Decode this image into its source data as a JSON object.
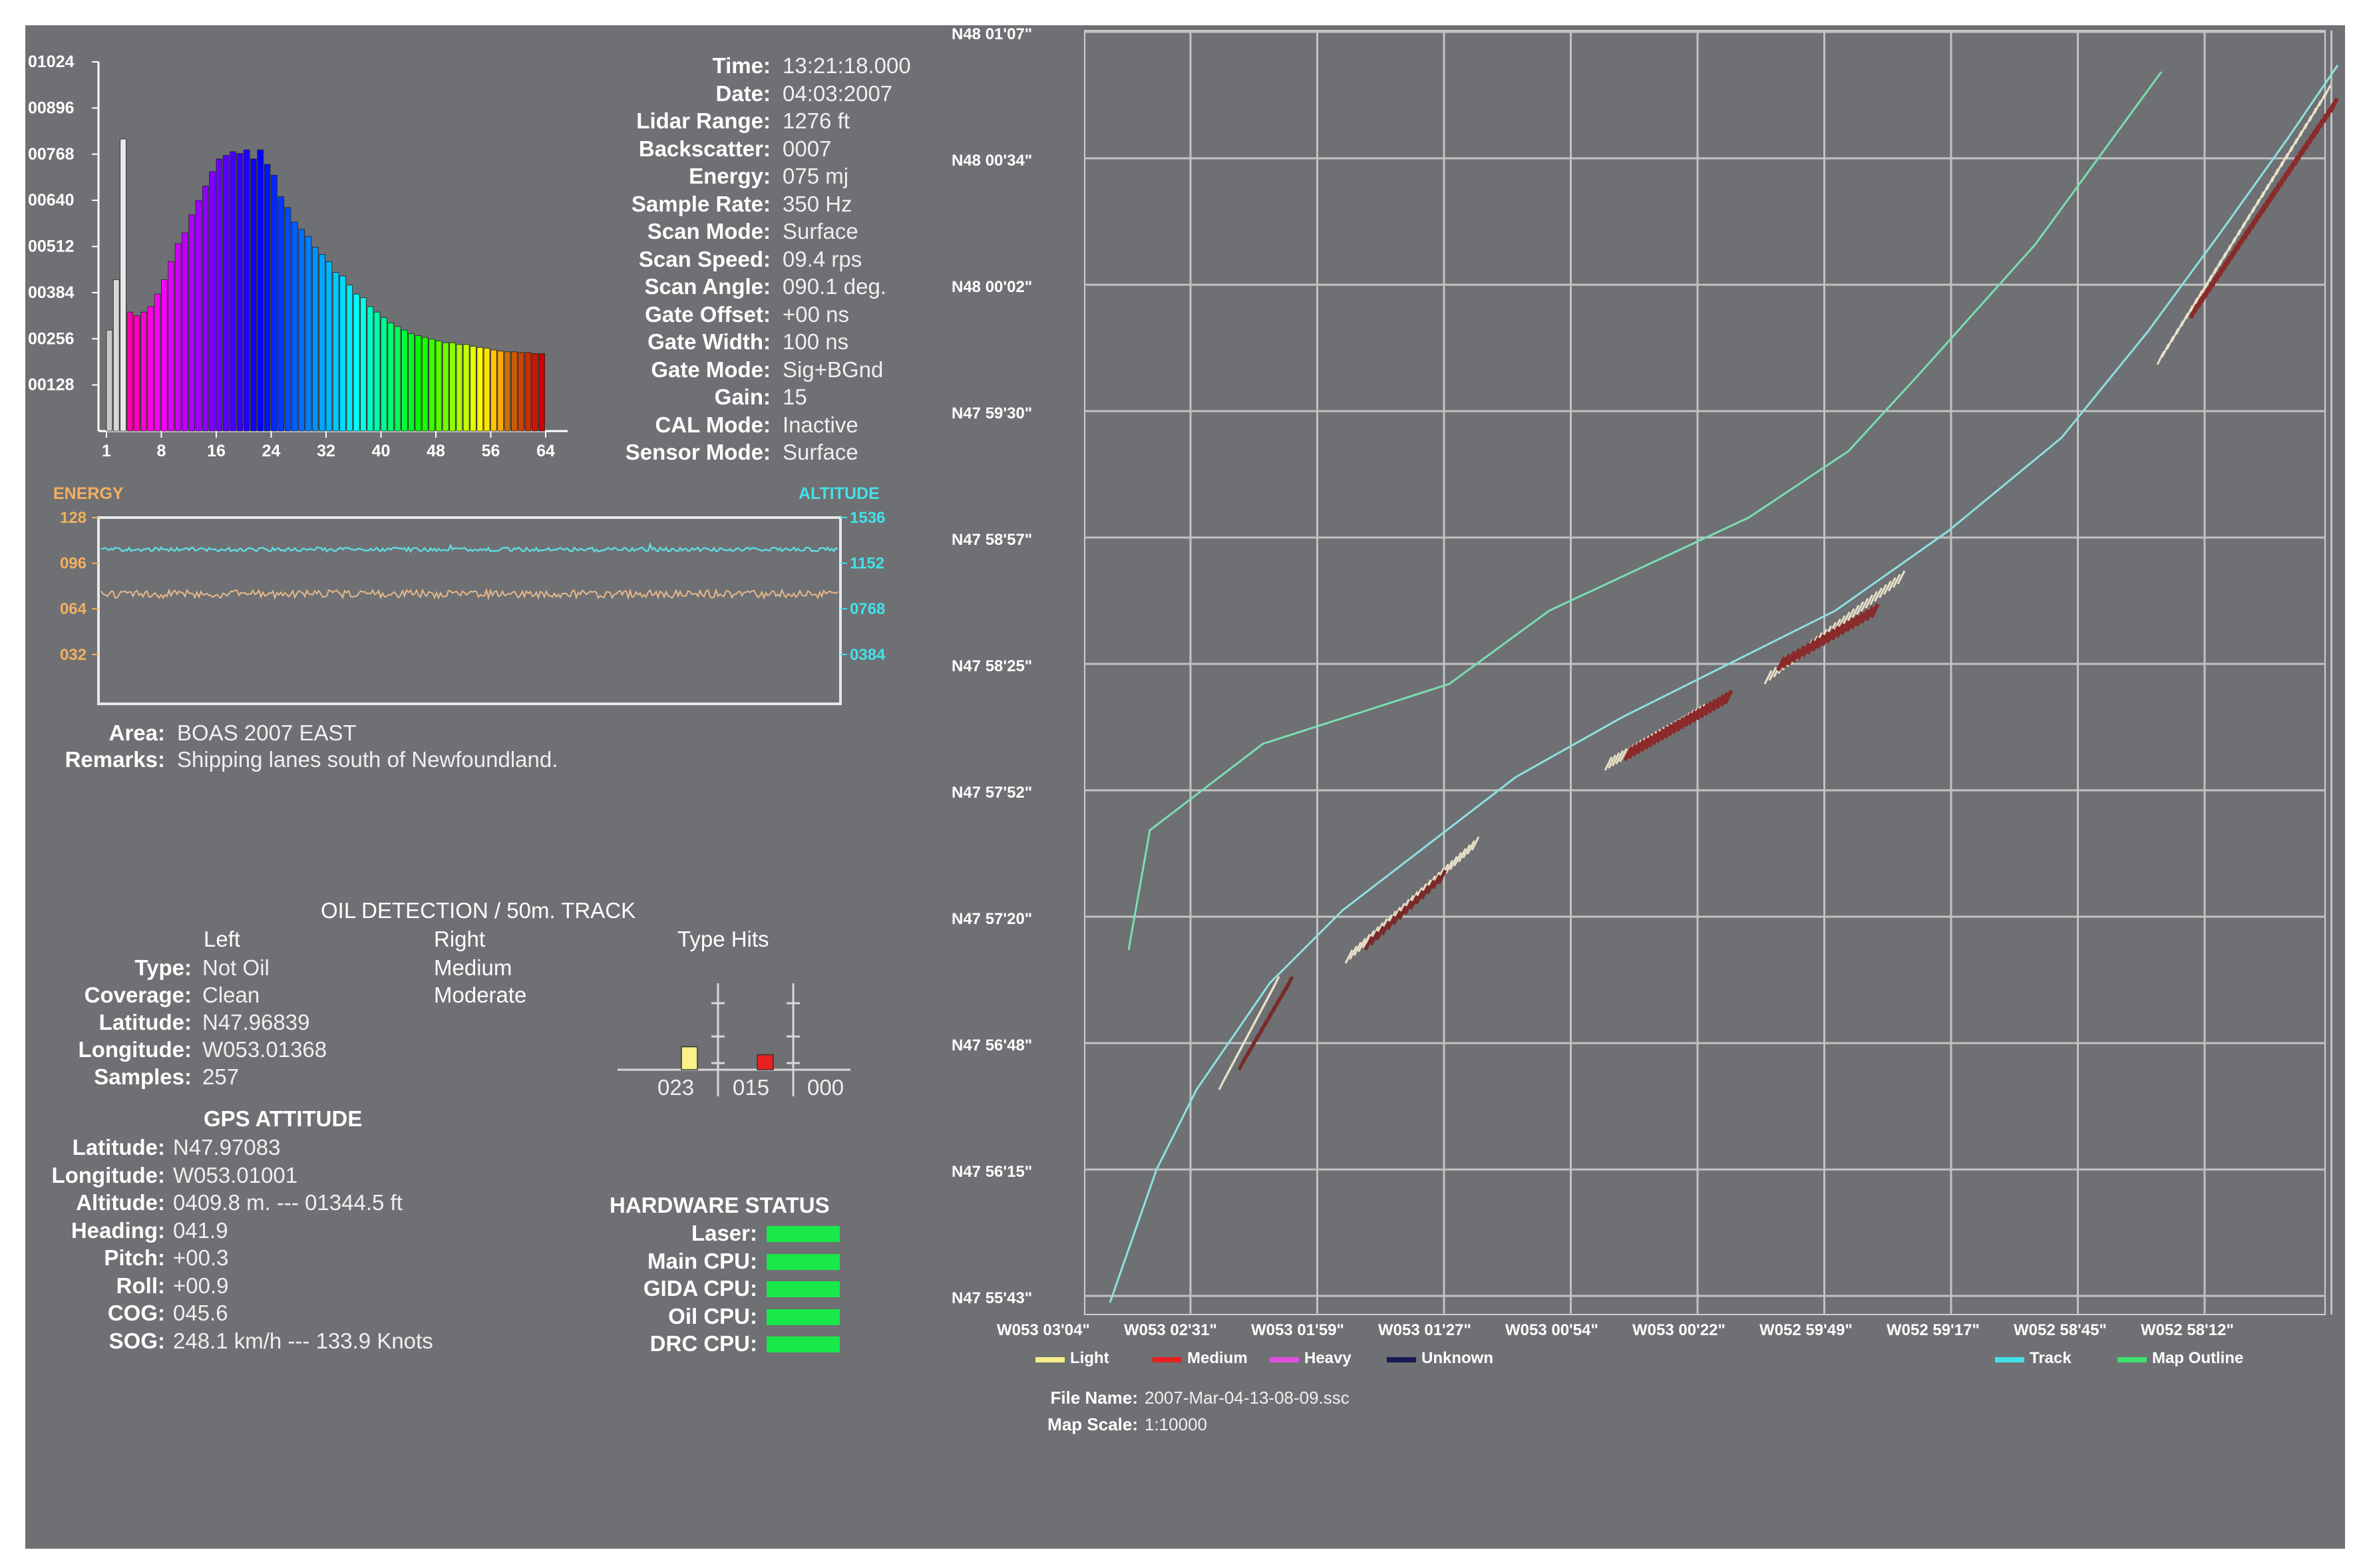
{
  "info": {
    "fields": [
      {
        "label": "Time:",
        "value": "13:21:18.000"
      },
      {
        "label": "Date:",
        "value": "04:03:2007"
      },
      {
        "label": "Lidar Range:",
        "value": "1276 ft"
      },
      {
        "label": "Backscatter:",
        "value": "0007"
      },
      {
        "label": "Energy:",
        "value": "075 mj"
      },
      {
        "label": "Sample Rate:",
        "value": "350 Hz"
      },
      {
        "label": "Scan Mode:",
        "value": "Surface"
      },
      {
        "label": "Scan Speed:",
        "value": "09.4 rps"
      },
      {
        "label": "Scan Angle:",
        "value": "090.1 deg."
      },
      {
        "label": "Gate Offset:",
        "value": "+00 ns"
      },
      {
        "label": "Gate Width:",
        "value": "100 ns"
      },
      {
        "label": "Gate Mode:",
        "value": "Sig+BGnd"
      },
      {
        "label": "Gain:",
        "value": "15"
      },
      {
        "label": "CAL Mode:",
        "value": "Inactive"
      },
      {
        "label": "Sensor Mode:",
        "value": "Surface"
      }
    ]
  },
  "histogram": {
    "y_ticks": [
      "01024",
      "00896",
      "00768",
      "00640",
      "00512",
      "00384",
      "00256",
      "00128"
    ],
    "x_ticks": [
      "1",
      "8",
      "16",
      "24",
      "32",
      "40",
      "48",
      "56",
      "64"
    ]
  },
  "chart_data": [
    {
      "type": "bar",
      "title": "",
      "x_ticks": [
        1,
        8,
        16,
        24,
        32,
        40,
        48,
        56,
        64
      ],
      "ylim": [
        0,
        1024
      ],
      "categories": [
        1,
        2,
        3,
        4,
        5,
        6,
        7,
        8,
        9,
        10,
        11,
        12,
        13,
        14,
        15,
        16,
        17,
        18,
        19,
        20,
        21,
        22,
        23,
        24,
        25,
        26,
        27,
        28,
        29,
        30,
        31,
        32,
        33,
        34,
        35,
        36,
        37,
        38,
        39,
        40,
        41,
        42,
        43,
        44,
        45,
        46,
        47,
        48,
        49,
        50,
        51,
        52,
        53,
        54,
        55,
        56,
        57,
        58,
        59,
        60,
        61,
        62,
        63,
        64
      ],
      "values": [
        280,
        420,
        810,
        330,
        320,
        330,
        345,
        380,
        420,
        470,
        520,
        550,
        600,
        640,
        680,
        720,
        755,
        765,
        775,
        770,
        780,
        755,
        780,
        740,
        710,
        650,
        620,
        580,
        560,
        540,
        510,
        490,
        470,
        440,
        430,
        405,
        380,
        370,
        345,
        330,
        315,
        300,
        290,
        280,
        270,
        265,
        260,
        255,
        250,
        245,
        245,
        240,
        240,
        235,
        232,
        230,
        225,
        222,
        220,
        220,
        218,
        218,
        215,
        215
      ]
    },
    {
      "type": "line",
      "x_ticks": [],
      "ylim_left": [
        0,
        128
      ],
      "ylim_right": [
        0,
        1536
      ],
      "y_ticks_left": [
        "128",
        "096",
        "064",
        "032"
      ],
      "y_ticks_right": [
        "1536",
        "1152",
        "0768",
        "0384"
      ],
      "series": [
        {
          "name": "ENERGY",
          "axis": "left",
          "mean": 72
        },
        {
          "name": "ALTITUDE",
          "axis": "right",
          "mean": 1200
        }
      ]
    }
  ],
  "timeseries": {
    "energy_label": "ENERGY",
    "altitude_label": "ALTITUDE",
    "left_ticks": [
      "128",
      "096",
      "064",
      "032"
    ],
    "right_ticks": [
      "1536",
      "1152",
      "0768",
      "0384"
    ]
  },
  "area": {
    "label": "Area:",
    "value": "BOAS 2007 EAST"
  },
  "remarks": {
    "label": "Remarks:",
    "value": "Shipping lanes south of Newfoundland."
  },
  "oil": {
    "title": "OIL DETECTION / 50m. TRACK",
    "left_header": "Left",
    "right_header": "Right",
    "type_hits_header": "Type Hits",
    "rows": [
      {
        "label": "Type:",
        "left": "Not Oil",
        "right": "Medium"
      },
      {
        "label": "Coverage:",
        "left": "Clean",
        "right": "Moderate"
      },
      {
        "label": "Latitude:",
        "left": "N47.96839",
        "right": ""
      },
      {
        "label": "Longitude:",
        "left": "W053.01368",
        "right": ""
      },
      {
        "label": "Samples:",
        "left": "257",
        "right": ""
      }
    ],
    "hits": [
      "023",
      "015",
      "000"
    ],
    "hit_colors": [
      "#f8f08a",
      "#e82020",
      "#222266"
    ]
  },
  "gps": {
    "title": "GPS ATTITUDE",
    "rows": [
      {
        "label": "Latitude:",
        "value": "N47.97083"
      },
      {
        "label": "Longitude:",
        "value": "W053.01001"
      },
      {
        "label": "Altitude:",
        "value": "0409.8 m. --- 01344.5 ft"
      },
      {
        "label": "Heading:",
        "value": "041.9"
      },
      {
        "label": "Pitch:",
        "value": "+00.3"
      },
      {
        "label": "Roll:",
        "value": "+00.9"
      },
      {
        "label": "COG:",
        "value": "045.6"
      },
      {
        "label": "SOG:",
        "value": "248.1 km/h --- 133.9 Knots"
      }
    ]
  },
  "hardware": {
    "title": "HARDWARE STATUS",
    "items": [
      {
        "label": "Laser:",
        "status": "ok"
      },
      {
        "label": "Main CPU:",
        "status": "ok"
      },
      {
        "label": "GIDA CPU:",
        "status": "ok"
      },
      {
        "label": "Oil CPU:",
        "status": "ok"
      },
      {
        "label": "DRC CPU:",
        "status": "ok"
      }
    ],
    "ok_color": "#19e84a"
  },
  "map": {
    "lat_labels": [
      "N48 01'07\"",
      "N48 00'34\"",
      "N48 00'02\"",
      "N47 59'30\"",
      "N47 58'57\"",
      "N47 58'25\"",
      "N47 57'52\"",
      "N47 57'20\"",
      "N47 56'48\"",
      "N47 56'15\"",
      "N47 55'43\""
    ],
    "lon_labels": [
      "W053 03'04\"",
      "W053 02'31\"",
      "W053 01'59\"",
      "W053 01'27\"",
      "W053 00'54\"",
      "W053 00'22\"",
      "W052 59'49\"",
      "W052 59'17\"",
      "W052 58'45\"",
      "W052 58'12\""
    ],
    "legend": [
      {
        "label": "Light",
        "color": "#f4ee8a"
      },
      {
        "label": "Medium",
        "color": "#e82020"
      },
      {
        "label": "Heavy",
        "color": "#e050e0"
      },
      {
        "label": "Unknown",
        "color": "#1a1a55"
      }
    ],
    "legend_right": [
      {
        "label": "Track",
        "color": "#44e0e8"
      },
      {
        "label": "Map Outline",
        "color": "#3ce070"
      }
    ],
    "file_name_label": "File Name:",
    "file_name": "2007-Mar-04-13-08-09.ssc",
    "map_scale_label": "Map Scale:",
    "map_scale": "1:10000"
  }
}
